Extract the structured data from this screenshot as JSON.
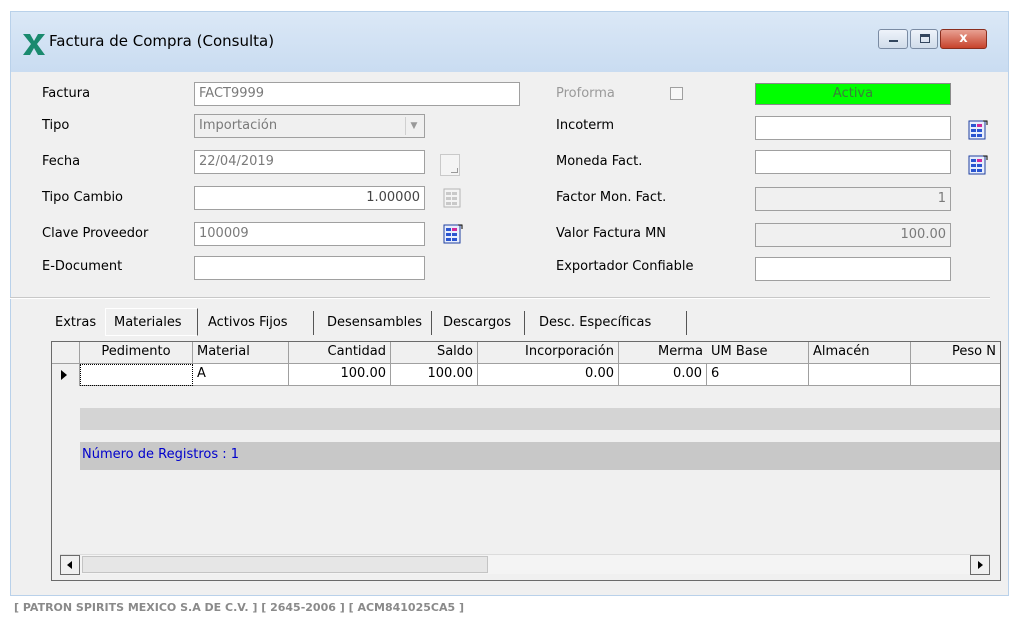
{
  "window": {
    "title": "Factura de Compra (Consulta)",
    "close_glyph": "x"
  },
  "form": {
    "factura": {
      "label": "Factura",
      "value": "FACT9999"
    },
    "tipo": {
      "label": "Tipo",
      "value": "Importación"
    },
    "fecha": {
      "label": "Fecha",
      "value": "22/04/2019"
    },
    "tipo_cambio": {
      "label": "Tipo Cambio",
      "value": "1.00000"
    },
    "clave_proveedor": {
      "label": "Clave Proveedor",
      "value": "100009"
    },
    "e_document": {
      "label": "E-Document",
      "value": ""
    },
    "proforma": {
      "label": "Proforma"
    },
    "status": {
      "value": "Activa",
      "color": "#00ff00"
    },
    "incoterm": {
      "label": "Incoterm",
      "value": ""
    },
    "moneda_fact": {
      "label": "Moneda Fact.",
      "value": ""
    },
    "factor_mon_fact": {
      "label": "Factor Mon. Fact.",
      "value": "1"
    },
    "valor_factura_mn": {
      "label": "Valor Factura MN",
      "value": "100.00"
    },
    "exportador_confiable": {
      "label": "Exportador Confiable",
      "value": ""
    }
  },
  "tabs": [
    {
      "label": "Extras"
    },
    {
      "label": "Materiales"
    },
    {
      "label": "Activos Fijos"
    },
    {
      "label": "Desensambles"
    },
    {
      "label": "Descargos"
    },
    {
      "label": "Desc. Específicas"
    }
  ],
  "grid": {
    "columns": [
      "Pedimento",
      "Material",
      "Cantidad",
      "Saldo",
      "Incorporación",
      "Merma",
      "UM Base",
      "Almacén",
      "Peso N"
    ],
    "rows": [
      [
        "",
        "A",
        "100.00",
        "100.00",
        "0.00",
        "0.00",
        "6",
        "",
        ""
      ]
    ],
    "record_count": "Número de Registros : 1"
  },
  "footer": {
    "text": "[ PATRON SPIRITS MEXICO S.A DE C.V. ]  [ 2645-2006 ]  [ ACM841025CA5 ]"
  }
}
